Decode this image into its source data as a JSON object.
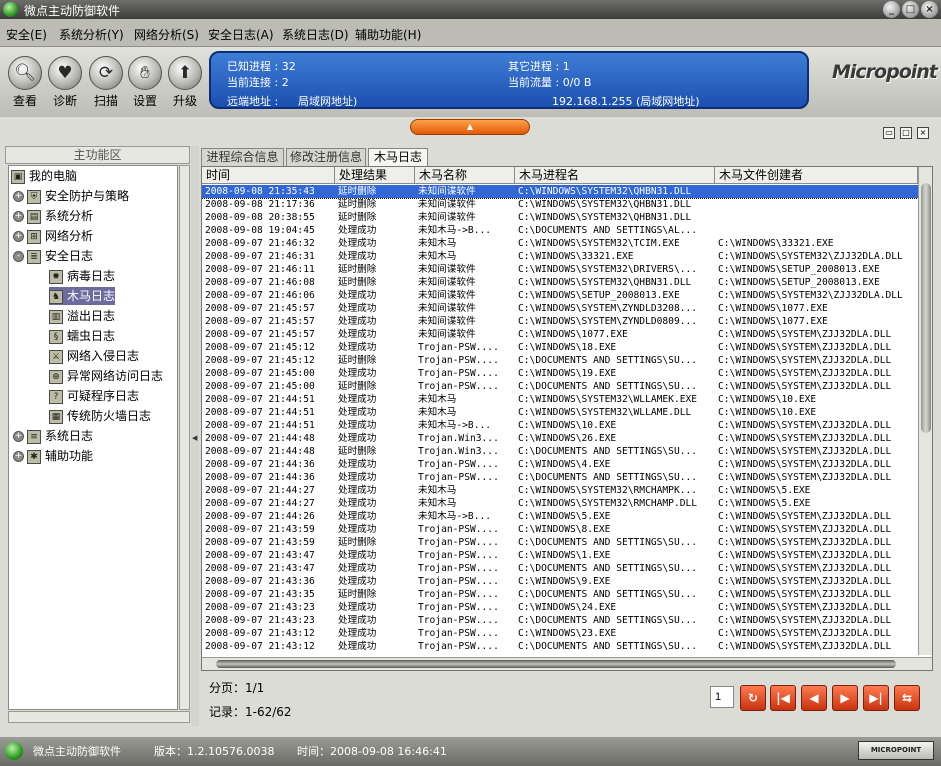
{
  "app": {
    "title": "微点主动防御软件"
  },
  "menu": [
    {
      "label": "安全(E)"
    },
    {
      "label": "系统分析(Y)"
    },
    {
      "label": "网络分析(S)"
    },
    {
      "label": "安全日志(A)"
    },
    {
      "label": "系统日志(D)"
    },
    {
      "label": "辅助功能(H)"
    }
  ],
  "toolbar": [
    {
      "label": "查看",
      "icon": "magnifier-icon"
    },
    {
      "label": "诊断",
      "icon": "heart-icon"
    },
    {
      "label": "扫描",
      "icon": "scan-icon"
    },
    {
      "label": "设置",
      "icon": "hand-icon"
    },
    {
      "label": "升级",
      "icon": "upgrade-icon"
    }
  ],
  "info": {
    "known_proc": "已知进程 : 32",
    "other_proc": "其它进程 : 1",
    "connections": "当前连接 : 2",
    "traffic": "当前流量 : 0/0 B",
    "remote_label": "远端地址 :",
    "remote_name": "局域网地址)",
    "remote_ip": "192.168.1.255 (局域网地址)"
  },
  "logo": "Micropoint",
  "left_panel": {
    "header": "主功能区",
    "tree": [
      {
        "label": "我的电脑",
        "icon": "computer-icon",
        "level": 0,
        "expander": "",
        "selected": false
      },
      {
        "label": "安全防护与策略",
        "icon": "shield-icon",
        "level": 1,
        "expander": "+",
        "selected": false
      },
      {
        "label": "系统分析",
        "icon": "system-icon",
        "level": 1,
        "expander": "+",
        "selected": false
      },
      {
        "label": "网络分析",
        "icon": "network-icon",
        "level": 1,
        "expander": "+",
        "selected": false
      },
      {
        "label": "安全日志",
        "icon": "log-icon",
        "level": 1,
        "expander": "-",
        "selected": false
      },
      {
        "label": "病毒日志",
        "icon": "virus-icon",
        "level": 2,
        "expander": "",
        "selected": false
      },
      {
        "label": "木马日志",
        "icon": "trojan-icon",
        "level": 2,
        "expander": "",
        "selected": true
      },
      {
        "label": "溢出日志",
        "icon": "overflow-icon",
        "level": 2,
        "expander": "",
        "selected": false
      },
      {
        "label": "蠕虫日志",
        "icon": "worm-icon",
        "level": 2,
        "expander": "",
        "selected": false
      },
      {
        "label": "网络入侵日志",
        "icon": "intrusion-icon",
        "level": 2,
        "expander": "",
        "selected": false
      },
      {
        "label": "异常网络访问日志",
        "icon": "abnormal-net-icon",
        "level": 2,
        "expander": "",
        "selected": false
      },
      {
        "label": "可疑程序日志",
        "icon": "suspicious-icon",
        "level": 2,
        "expander": "",
        "selected": false
      },
      {
        "label": "传统防火墙日志",
        "icon": "firewall-icon",
        "level": 2,
        "expander": "",
        "selected": false
      },
      {
        "label": "系统日志",
        "icon": "syslog-icon",
        "level": 1,
        "expander": "+",
        "selected": false
      },
      {
        "label": "辅助功能",
        "icon": "helper-icon",
        "level": 1,
        "expander": "+",
        "selected": false
      }
    ]
  },
  "tabs": [
    {
      "label": "进程综合信息",
      "active": false
    },
    {
      "label": "修改注册信息",
      "active": false
    },
    {
      "label": "木马日志",
      "active": true
    }
  ],
  "grid": {
    "columns": [
      "时间",
      "处理结果",
      "木马名称",
      "木马进程名",
      "木马文件创建者"
    ],
    "rows": [
      [
        "2008-09-08 21:35:43",
        "延时删除",
        "未知间谍软件",
        "C:\\WINDOWS\\SYSTEM32\\QHBN31.DLL",
        ""
      ],
      [
        "2008-09-08 21:17:36",
        "延时删除",
        "未知间谍软件",
        "C:\\WINDOWS\\SYSTEM32\\QHBN31.DLL",
        ""
      ],
      [
        "2008-09-08 20:38:55",
        "延时删除",
        "未知间谍软件",
        "C:\\WINDOWS\\SYSTEM32\\QHBN31.DLL",
        ""
      ],
      [
        "2008-09-08 19:04:45",
        "处理成功",
        "未知木马->B...",
        "C:\\DOCUMENTS AND SETTINGS\\AL...",
        ""
      ],
      [
        "2008-09-07 21:46:32",
        "处理成功",
        "未知木马",
        "C:\\WINDOWS\\SYSTEM32\\TCIM.EXE",
        "C:\\WINDOWS\\33321.EXE"
      ],
      [
        "2008-09-07 21:46:31",
        "处理成功",
        "未知木马",
        "C:\\WINDOWS\\33321.EXE",
        "C:\\WINDOWS\\SYSTEM32\\ZJJ32DLA.DLL"
      ],
      [
        "2008-09-07 21:46:11",
        "延时删除",
        "未知间谍软件",
        "C:\\WINDOWS\\SYSTEM32\\DRIVERS\\...",
        "C:\\WINDOWS\\SETUP_2008013.EXE"
      ],
      [
        "2008-09-07 21:46:08",
        "延时删除",
        "未知间谍软件",
        "C:\\WINDOWS\\SYSTEM32\\QHBN31.DLL",
        "C:\\WINDOWS\\SETUP_2008013.EXE"
      ],
      [
        "2008-09-07 21:46:06",
        "处理成功",
        "未知间谍软件",
        "C:\\WINDOWS\\SETUP_2008013.EXE",
        "C:\\WINDOWS\\SYSTEM32\\ZJJ32DLA.DLL"
      ],
      [
        "2008-09-07 21:45:57",
        "处理成功",
        "未知间谍软件",
        "C:\\WINDOWS\\SYSTEM\\ZYNDLD3208...",
        "C:\\WINDOWS\\1077.EXE"
      ],
      [
        "2008-09-07 21:45:57",
        "处理成功",
        "未知间谍软件",
        "C:\\WINDOWS\\SYSTEM\\ZYNDLD0809...",
        "C:\\WINDOWS\\1077.EXE"
      ],
      [
        "2008-09-07 21:45:57",
        "处理成功",
        "未知间谍软件",
        "C:\\WINDOWS\\1077.EXE",
        "C:\\WINDOWS\\SYSTEM\\ZJJ32DLA.DLL"
      ],
      [
        "2008-09-07 21:45:12",
        "处理成功",
        "Trojan-PSW....",
        "C:\\WINDOWS\\18.EXE",
        "C:\\WINDOWS\\SYSTEM\\ZJJ32DLA.DLL"
      ],
      [
        "2008-09-07 21:45:12",
        "延时删除",
        "Trojan-PSW....",
        "C:\\DOCUMENTS AND SETTINGS\\SU...",
        "C:\\WINDOWS\\SYSTEM\\ZJJ32DLA.DLL"
      ],
      [
        "2008-09-07 21:45:00",
        "处理成功",
        "Trojan-PSW....",
        "C:\\WINDOWS\\19.EXE",
        "C:\\WINDOWS\\SYSTEM\\ZJJ32DLA.DLL"
      ],
      [
        "2008-09-07 21:45:00",
        "延时删除",
        "Trojan-PSW....",
        "C:\\DOCUMENTS AND SETTINGS\\SU...",
        "C:\\WINDOWS\\SYSTEM\\ZJJ32DLA.DLL"
      ],
      [
        "2008-09-07 21:44:51",
        "处理成功",
        "未知木马",
        "C:\\WINDOWS\\SYSTEM32\\WLLAMEK.EXE",
        "C:\\WINDOWS\\10.EXE"
      ],
      [
        "2008-09-07 21:44:51",
        "处理成功",
        "未知木马",
        "C:\\WINDOWS\\SYSTEM32\\WLLAME.DLL",
        "C:\\WINDOWS\\10.EXE"
      ],
      [
        "2008-09-07 21:44:51",
        "处理成功",
        "未知木马->B...",
        "C:\\WINDOWS\\10.EXE",
        "C:\\WINDOWS\\SYSTEM\\ZJJ32DLA.DLL"
      ],
      [
        "2008-09-07 21:44:48",
        "处理成功",
        "Trojan.Win3...",
        "C:\\WINDOWS\\26.EXE",
        "C:\\WINDOWS\\SYSTEM\\ZJJ32DLA.DLL"
      ],
      [
        "2008-09-07 21:44:48",
        "延时删除",
        "Trojan.Win3...",
        "C:\\DOCUMENTS AND SETTINGS\\SU...",
        "C:\\WINDOWS\\SYSTEM\\ZJJ32DLA.DLL"
      ],
      [
        "2008-09-07 21:44:36",
        "处理成功",
        "Trojan-PSW....",
        "C:\\WINDOWS\\4.EXE",
        "C:\\WINDOWS\\SYSTEM\\ZJJ32DLA.DLL"
      ],
      [
        "2008-09-07 21:44:36",
        "处理成功",
        "Trojan-PSW....",
        "C:\\DOCUMENTS AND SETTINGS\\SU...",
        "C:\\WINDOWS\\SYSTEM\\ZJJ32DLA.DLL"
      ],
      [
        "2008-09-07 21:44:27",
        "处理成功",
        "未知木马",
        "C:\\WINDOWS\\SYSTEM32\\RMCHAMPK...",
        "C:\\WINDOWS\\5.EXE"
      ],
      [
        "2008-09-07 21:44:27",
        "处理成功",
        "未知木马",
        "C:\\WINDOWS\\SYSTEM32\\RMCHAMP.DLL",
        "C:\\WINDOWS\\5.EXE"
      ],
      [
        "2008-09-07 21:44:26",
        "处理成功",
        "未知木马->B...",
        "C:\\WINDOWS\\5.EXE",
        "C:\\WINDOWS\\SYSTEM\\ZJJ32DLA.DLL"
      ],
      [
        "2008-09-07 21:43:59",
        "处理成功",
        "Trojan-PSW....",
        "C:\\WINDOWS\\8.EXE",
        "C:\\WINDOWS\\SYSTEM\\ZJJ32DLA.DLL"
      ],
      [
        "2008-09-07 21:43:59",
        "延时删除",
        "Trojan-PSW....",
        "C:\\DOCUMENTS AND SETTINGS\\SU...",
        "C:\\WINDOWS\\SYSTEM\\ZJJ32DLA.DLL"
      ],
      [
        "2008-09-07 21:43:47",
        "处理成功",
        "Trojan-PSW....",
        "C:\\WINDOWS\\1.EXE",
        "C:\\WINDOWS\\SYSTEM\\ZJJ32DLA.DLL"
      ],
      [
        "2008-09-07 21:43:47",
        "处理成功",
        "Trojan-PSW....",
        "C:\\DOCUMENTS AND SETTINGS\\SU...",
        "C:\\WINDOWS\\SYSTEM\\ZJJ32DLA.DLL"
      ],
      [
        "2008-09-07 21:43:36",
        "处理成功",
        "Trojan-PSW....",
        "C:\\WINDOWS\\9.EXE",
        "C:\\WINDOWS\\SYSTEM\\ZJJ32DLA.DLL"
      ],
      [
        "2008-09-07 21:43:35",
        "延时删除",
        "Trojan-PSW....",
        "C:\\DOCUMENTS AND SETTINGS\\SU...",
        "C:\\WINDOWS\\SYSTEM\\ZJJ32DLA.DLL"
      ],
      [
        "2008-09-07 21:43:23",
        "处理成功",
        "Trojan-PSW....",
        "C:\\WINDOWS\\24.EXE",
        "C:\\WINDOWS\\SYSTEM\\ZJJ32DLA.DLL"
      ],
      [
        "2008-09-07 21:43:23",
        "处理成功",
        "Trojan-PSW....",
        "C:\\DOCUMENTS AND SETTINGS\\SU...",
        "C:\\WINDOWS\\SYSTEM\\ZJJ32DLA.DLL"
      ],
      [
        "2008-09-07 21:43:12",
        "处理成功",
        "Trojan-PSW....",
        "C:\\WINDOWS\\23.EXE",
        "C:\\WINDOWS\\SYSTEM\\ZJJ32DLA.DLL"
      ],
      [
        "2008-09-07 21:43:12",
        "处理成功",
        "Trojan-PSW....",
        "C:\\DOCUMENTS AND SETTINGS\\SU...",
        "C:\\WINDOWS\\SYSTEM\\ZJJ32DLA.DLL"
      ]
    ],
    "selected_row": 0
  },
  "pager": {
    "page_label": "分页：1/1",
    "record_label": "记录：1-62/62",
    "page_input": "1",
    "buttons": [
      {
        "name": "refresh-button",
        "glyph": "↻"
      },
      {
        "name": "first-page-button",
        "glyph": "|◀"
      },
      {
        "name": "prev-page-button",
        "glyph": "◀"
      },
      {
        "name": "next-page-button",
        "glyph": "▶"
      },
      {
        "name": "last-page-button",
        "glyph": "▶|"
      },
      {
        "name": "go-page-button",
        "glyph": "⇆"
      }
    ]
  },
  "statusbar": {
    "app": "微点主动防御软件",
    "version": "版本：1.2.10576.0038",
    "time": "时间：2008-09-08 16:46:41",
    "logo": "MICROPOINT"
  },
  "colors": {
    "selection": "#3168d5",
    "tree_selection": "#6b6b9e",
    "info_panel": "#2a62c4",
    "accent_orange": "#f07a1e"
  }
}
